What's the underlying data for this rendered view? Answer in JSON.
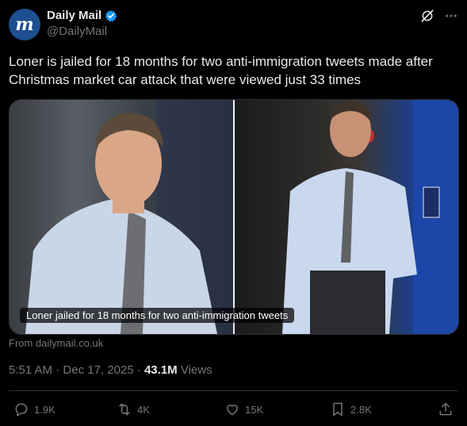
{
  "author": {
    "avatar_text": "m",
    "name": "Daily Mail",
    "handle": "@DailyMail"
  },
  "tweet": {
    "text": "Loner is jailed for 18 months for two anti-immigration tweets made after Christmas market car attack that were viewed just 33 times"
  },
  "card": {
    "caption": "Loner jailed for 18 months for two anti-immigration tweets",
    "source": "From dailymail.co.uk"
  },
  "meta": {
    "time": "5:51 AM",
    "date": "Dec 17, 2025",
    "views_count": "43.1M",
    "views_label": "Views"
  },
  "actions": {
    "replies": "1.9K",
    "reposts": "4K",
    "likes": "15K",
    "bookmarks": "2.8K"
  },
  "colors": {
    "background": "#000000",
    "text": "#e7e9ea",
    "muted": "#71767b",
    "verified": "#1d9bf0",
    "avatar": "#1d4f91"
  },
  "icons": [
    "verified-badge-icon",
    "grok-icon",
    "more-icon",
    "reply-icon",
    "repost-icon",
    "like-icon",
    "bookmark-icon",
    "share-icon"
  ]
}
